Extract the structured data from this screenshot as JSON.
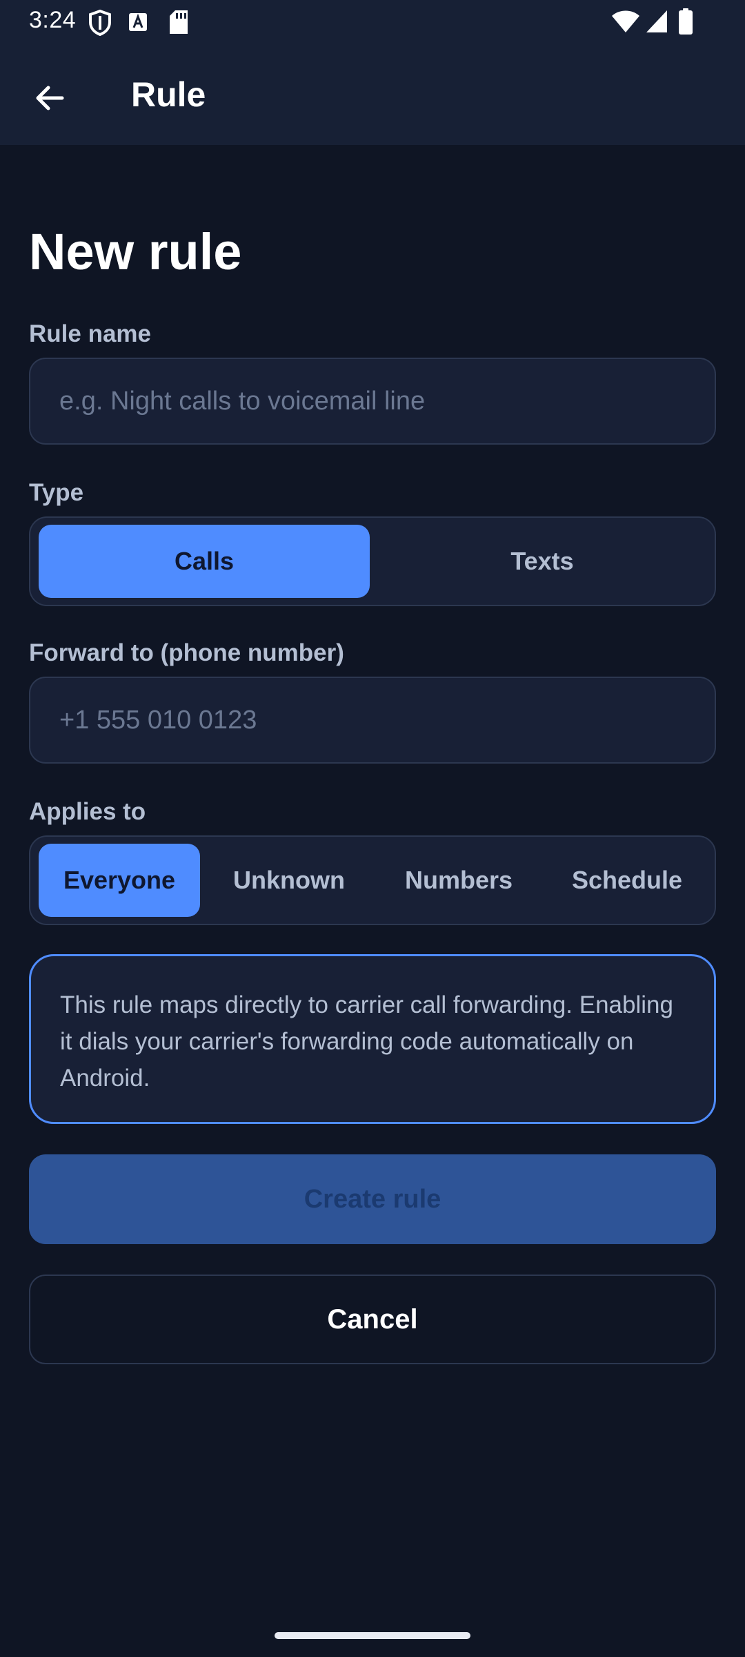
{
  "status_bar": {
    "time": "3:24",
    "icons_left": [
      "shield-icon",
      "font-a-icon",
      "sd-card-icon"
    ],
    "icons_right": [
      "wifi-icon",
      "signal-icon",
      "battery-icon"
    ]
  },
  "app_bar": {
    "back_icon": "arrow-left-icon",
    "title": "Rule"
  },
  "form": {
    "heading": "New rule",
    "rule_name": {
      "label": "Rule name",
      "value": "",
      "placeholder": "e.g. Night calls to voicemail line"
    },
    "type": {
      "label": "Type",
      "options": [
        "Calls",
        "Texts"
      ],
      "selected": "Calls"
    },
    "forward_to": {
      "label": "Forward to (phone number)",
      "value": "",
      "placeholder": "+1 555 010 0123"
    },
    "applies_to": {
      "label": "Applies to",
      "options": [
        "Everyone",
        "Unknown",
        "Numbers",
        "Schedule"
      ],
      "selected": "Everyone"
    },
    "info_text": "This rule maps directly to carrier call forwarding. Enabling it dials your carrier's forwarding code automatically on Android.",
    "create_label": "Create rule",
    "cancel_label": "Cancel"
  },
  "colors": {
    "background": "#0f1524",
    "surface": "#182036",
    "accent": "#4f8cff",
    "primary_disabled": "#2e5497"
  }
}
